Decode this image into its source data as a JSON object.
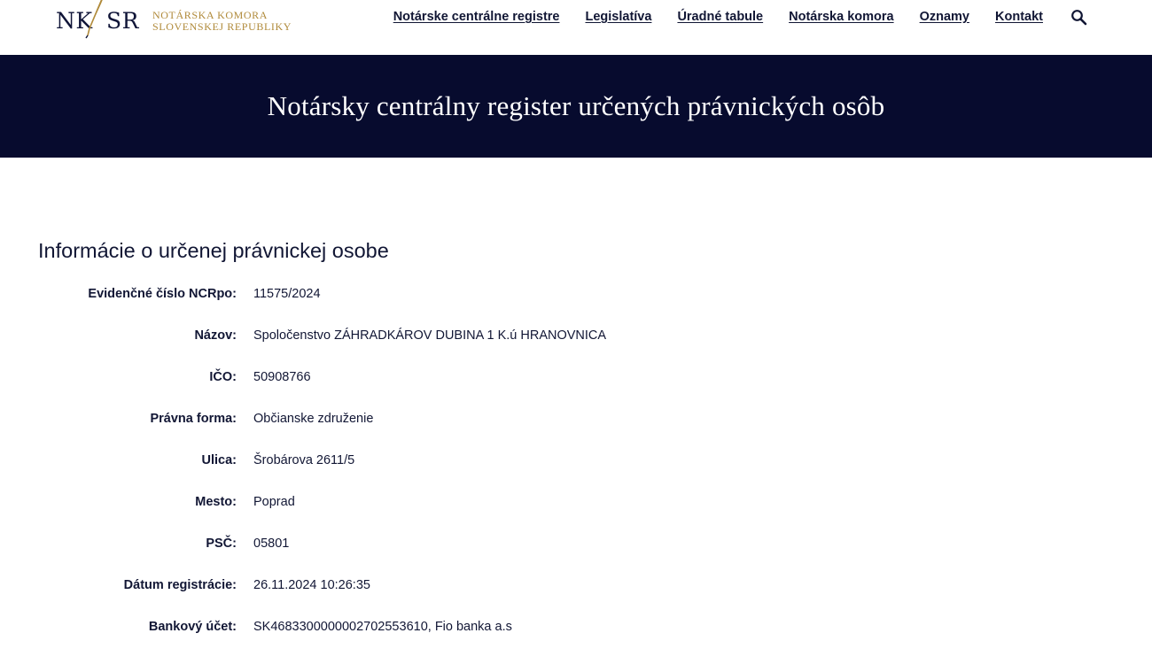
{
  "logo": {
    "abbr_left": "NK",
    "abbr_right": "SR",
    "line1": "NOTÁRSKA KOMORA",
    "line2": "SLOVENSKEJ REPUBLIKY",
    "quill_icon": "quill-icon"
  },
  "nav": {
    "items": [
      "Notárske centrálne registre",
      "Legislatíva",
      "Úradné tabule",
      "Notárska komora",
      "Oznamy",
      "Kontakt"
    ],
    "search_icon": "search-icon"
  },
  "banner": {
    "title": "Notársky centrálny register určených právnických osôb"
  },
  "section": {
    "title": "Informácie o určenej právnickej osobe"
  },
  "info_rows": [
    {
      "label": "Evidenčné číslo NCRpo:",
      "value": "11575/2024"
    },
    {
      "label": "Názov:",
      "value": "Spoločenstvo ZÁHRADKÁROV DUBINA 1 K.ú HRANOVNICA"
    },
    {
      "label": "IČO:",
      "value": "50908766"
    },
    {
      "label": "Právna forma:",
      "value": "Občianske združenie"
    },
    {
      "label": "Ulica:",
      "value": "Šrobárova 2611/5"
    },
    {
      "label": "Mesto:",
      "value": "Poprad"
    },
    {
      "label": "PSČ:",
      "value": "05801"
    },
    {
      "label": "Dátum registrácie:",
      "value": "26.11.2024 10:26:35"
    },
    {
      "label": "Bankový účet:",
      "value": "SK4683300000002702553610, Fio banka a.s"
    }
  ],
  "colors": {
    "banner_bg": "#070b2e",
    "logo_gold": "#b08a3a",
    "text_navy": "#111634"
  }
}
